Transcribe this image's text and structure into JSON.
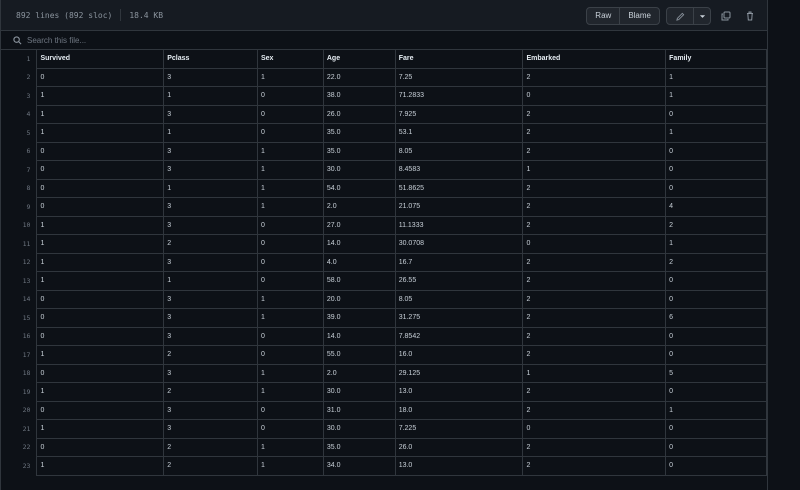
{
  "file": {
    "lines": "892 lines (892 sloc)",
    "size": "18.4 KB"
  },
  "toolbar": {
    "raw_label": "Raw",
    "blame_label": "Blame"
  },
  "search": {
    "placeholder": "Search this file..."
  },
  "headers": [
    "Survived",
    "Pclass",
    "Sex",
    "Age",
    "Fare",
    "Embarked",
    "Family"
  ],
  "rows": [
    [
      "0",
      "3",
      "1",
      "22.0",
      "7.25",
      "2",
      "1"
    ],
    [
      "1",
      "1",
      "0",
      "38.0",
      "71.2833",
      "0",
      "1"
    ],
    [
      "1",
      "3",
      "0",
      "26.0",
      "7.925",
      "2",
      "0"
    ],
    [
      "1",
      "1",
      "0",
      "35.0",
      "53.1",
      "2",
      "1"
    ],
    [
      "0",
      "3",
      "1",
      "35.0",
      "8.05",
      "2",
      "0"
    ],
    [
      "0",
      "3",
      "1",
      "30.0",
      "8.4583",
      "1",
      "0"
    ],
    [
      "0",
      "1",
      "1",
      "54.0",
      "51.8625",
      "2",
      "0"
    ],
    [
      "0",
      "3",
      "1",
      "2.0",
      "21.075",
      "2",
      "4"
    ],
    [
      "1",
      "3",
      "0",
      "27.0",
      "11.1333",
      "2",
      "2"
    ],
    [
      "1",
      "2",
      "0",
      "14.0",
      "30.0708",
      "0",
      "1"
    ],
    [
      "1",
      "3",
      "0",
      "4.0",
      "16.7",
      "2",
      "2"
    ],
    [
      "1",
      "1",
      "0",
      "58.0",
      "26.55",
      "2",
      "0"
    ],
    [
      "0",
      "3",
      "1",
      "20.0",
      "8.05",
      "2",
      "0"
    ],
    [
      "0",
      "3",
      "1",
      "39.0",
      "31.275",
      "2",
      "6"
    ],
    [
      "0",
      "3",
      "0",
      "14.0",
      "7.8542",
      "2",
      "0"
    ],
    [
      "1",
      "2",
      "0",
      "55.0",
      "16.0",
      "2",
      "0"
    ],
    [
      "0",
      "3",
      "1",
      "2.0",
      "29.125",
      "1",
      "5"
    ],
    [
      "1",
      "2",
      "1",
      "30.0",
      "13.0",
      "2",
      "0"
    ],
    [
      "0",
      "3",
      "0",
      "31.0",
      "18.0",
      "2",
      "1"
    ],
    [
      "1",
      "3",
      "0",
      "30.0",
      "7.225",
      "0",
      "0"
    ],
    [
      "0",
      "2",
      "1",
      "35.0",
      "26.0",
      "2",
      "0"
    ],
    [
      "1",
      "2",
      "1",
      "34.0",
      "13.0",
      "2",
      "0"
    ]
  ],
  "line_numbers": [
    "1",
    "2",
    "3",
    "4",
    "5",
    "6",
    "7",
    "8",
    "9",
    "10",
    "11",
    "12",
    "13",
    "14",
    "15",
    "16",
    "17",
    "18",
    "19",
    "20",
    "21",
    "22",
    "23"
  ]
}
